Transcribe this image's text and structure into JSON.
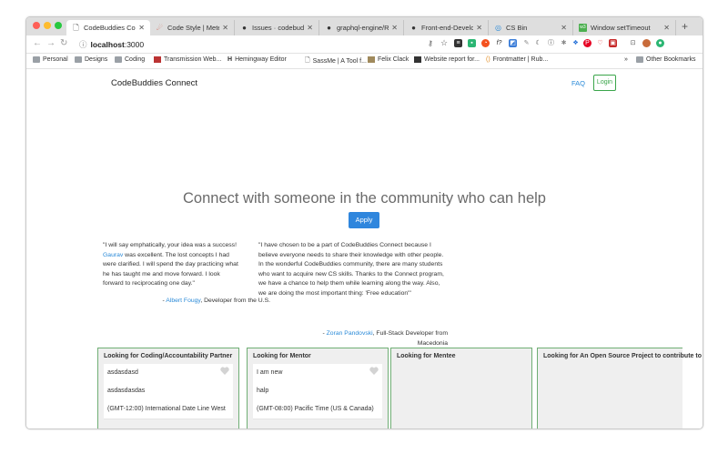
{
  "browser": {
    "tabs": [
      {
        "label": "CodeBuddies Conne",
        "icon": "page-icon",
        "active": true
      },
      {
        "label": "Code Style | Meteo",
        "icon": "meteor-icon"
      },
      {
        "label": "Issues · codebuddie",
        "icon": "github-icon"
      },
      {
        "label": "graphql-engine/REA",
        "icon": "github-icon"
      },
      {
        "label": "Front-end-Develope",
        "icon": "github-icon"
      },
      {
        "label": "CS Bin",
        "icon": "csbin-icon"
      },
      {
        "label": "Window setTimeout",
        "icon": "w3-icon"
      }
    ],
    "url_host": "localhost",
    "url_port": ":3000",
    "bookmarks": [
      "Personal",
      "Designs",
      "Coding",
      "Transmission Web...",
      "Hemingway Editor",
      "SassMe | A Tool f...",
      "Felix Clack",
      "Website report for...",
      "Frontmatter | Rub...",
      "»",
      "Other Bookmarks"
    ]
  },
  "header": {
    "brand": "CodeBuddies Connect",
    "faq": "FAQ",
    "login": "Login"
  },
  "hero": {
    "title": "Connect with someone in the community who can help",
    "apply": "Apply"
  },
  "testimonials": [
    {
      "text_before": "\"I will say emphatically, your idea was a success! ",
      "link": "Gaurav",
      "text_after": " was excellent. The lost concepts I had were clarified. I will spend the day practicing what he has taught me and move forward. I look forward to reciprocating one day.\"",
      "author_prefix": "- ",
      "author": "Albert Fougy",
      "author_suffix": ", Developer from the U.S."
    },
    {
      "text": "\"I have chosen to be a part of CodeBuddies Connect because I believe everyone needs to share their knowledge with other people. In the wonderful CodeBuddies community, there are many students who want to acquire new CS skills. Thanks to the Connect program, we have a chance to help them while learning along the way. Also, we are doing the most important thing: 'Free education'\"",
      "author_prefix": "- ",
      "author": "Zoran Pandovski",
      "author_suffix": ", Full-Stack Developer from Macedonia"
    }
  ],
  "cards": [
    {
      "title": "Looking for Coding/Accountability Partner",
      "entry": [
        "asdasdasd",
        "asdasdasdas",
        "(GMT-12:00) International Date Line West"
      ]
    },
    {
      "title": "Looking for Mentor",
      "entry": [
        "I am new",
        "halp",
        "(GMT-08:00) Pacific Time (US & Canada)"
      ]
    },
    {
      "title": "Looking for Mentee",
      "entry": []
    },
    {
      "title": "Looking for An Open Source Project to contribute to",
      "entry": []
    }
  ],
  "colors": {
    "accent": "#2f86dd",
    "link": "#2a8ad8",
    "login_green": "#3aa54a",
    "card_border": "#6fae74"
  }
}
